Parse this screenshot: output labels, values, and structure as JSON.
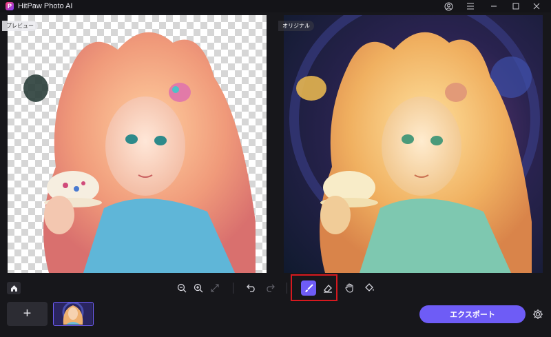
{
  "app": {
    "title": "HitPaw Photo AI",
    "logo_letter": "P"
  },
  "window_controls": [
    "account-icon",
    "menu-icon",
    "minimize-icon",
    "maximize-icon",
    "close-icon"
  ],
  "panels": {
    "preview_label": "プレビュー",
    "original_label": "オリジナル"
  },
  "toolbar": {
    "tools": [
      "home-icon",
      "zoom-out-icon",
      "zoom-in-icon",
      "fit-screen-icon",
      "undo-icon",
      "redo-icon",
      "brush-icon",
      "eraser-icon",
      "hand-icon",
      "fill-bucket-icon"
    ],
    "active_tool": "brush-icon"
  },
  "bottom": {
    "add_label": "+",
    "export_label": "エクスポート"
  },
  "colors": {
    "accent": "#6e5cf6",
    "highlight": "#d7191f",
    "background": "#17171b"
  }
}
